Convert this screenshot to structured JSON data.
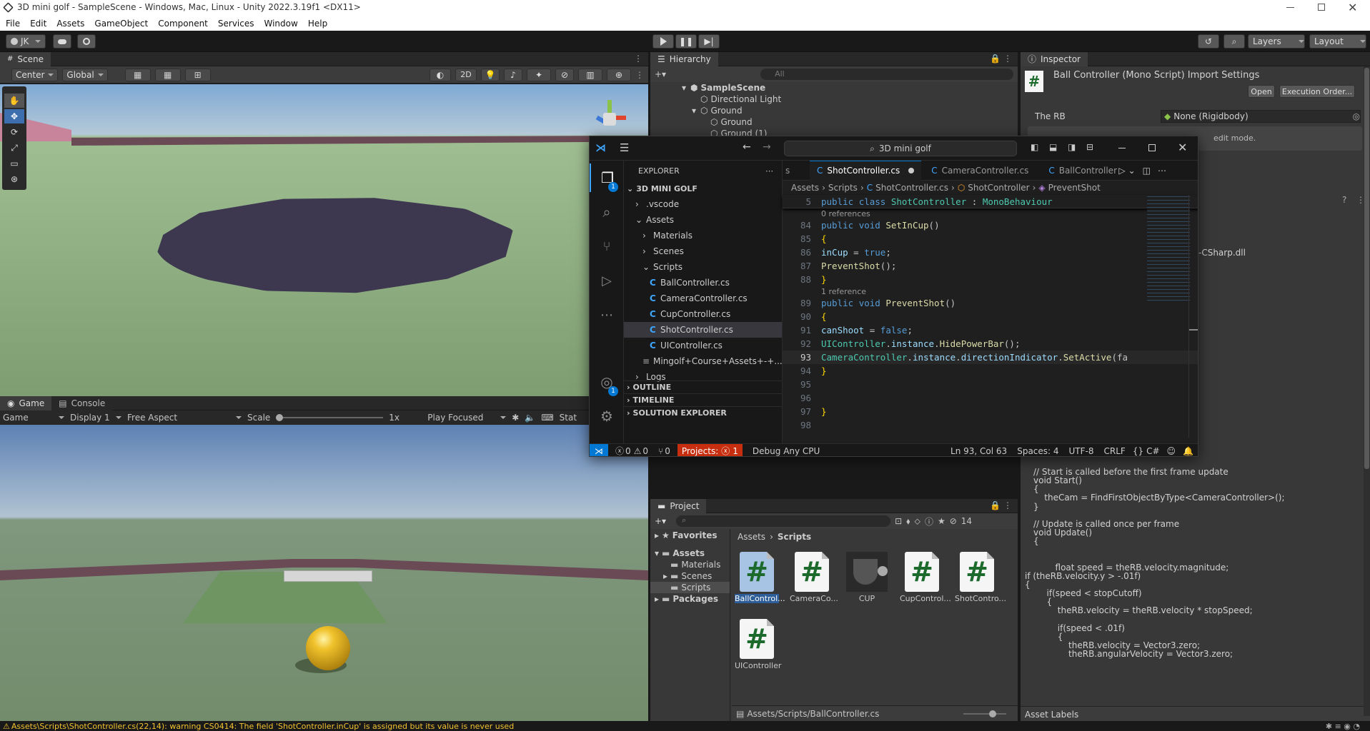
{
  "window_title": "3D mini golf - SampleScene - Windows, Mac, Linux - Unity 2022.3.19f1 <DX11>",
  "menu": [
    "File",
    "Edit",
    "Assets",
    "GameObject",
    "Component",
    "Services",
    "Window",
    "Help"
  ],
  "toolbar": {
    "account": "JK",
    "layers": "Layers",
    "layout": "Layout"
  },
  "scene": {
    "tab": "Scene",
    "pivot": "Center",
    "space": "Global",
    "mode2d": "2D"
  },
  "game": {
    "tab_game": "Game",
    "tab_console": "Console",
    "view": "Game",
    "display": "Display 1",
    "aspect": "Free Aspect",
    "scale_label": "Scale",
    "scale_value": "1x",
    "play_mode": "Play Focused",
    "stats": "Stat"
  },
  "hierarchy": {
    "tab": "Hierarchy",
    "search_placeholder": "All",
    "items": [
      {
        "label": "SampleScene",
        "indent": 0
      },
      {
        "label": "Directional Light",
        "indent": 1
      },
      {
        "label": "Ground",
        "indent": 1
      },
      {
        "label": "Ground",
        "indent": 2
      },
      {
        "label": "Ground (1)",
        "indent": 2
      }
    ]
  },
  "inspector": {
    "tab": "Inspector",
    "header": "Ball Controller (Mono Script) Import Settings",
    "open": "Open",
    "exec_order": "Execution Order...",
    "field_label": "The RB",
    "field_value": "None (Rigidbody)",
    "note": "edit mode.",
    "dll": "-CSharp.dll",
    "asset_labels": "Asset Labels",
    "code": [
      "// Start is called before the first frame update",
      "void Start()",
      "{",
      "    theCam = FindFirstObjectByType<CameraController>();",
      "}",
      "",
      "// Update is called once per frame",
      "void Update()",
      "{",
      "",
      "",
      "        float speed = theRB.velocity.magnitude;",
      "if (theRB.velocity.y > -.01f)",
      "{",
      "        if(speed < stopCutoff)",
      "        {",
      "            theRB.velocity = theRB.velocity * stopSpeed;",
      "",
      "            if(speed < .01f)",
      "            {",
      "                theRB.velocity = Vector3.zero;",
      "                theRB.angularVelocity = Vector3.zero;"
    ]
  },
  "project": {
    "tab": "Project",
    "hidden_count": "14",
    "favorites": "Favorites",
    "assets": "Assets",
    "folders": [
      "Materials",
      "Scenes",
      "Scripts"
    ],
    "packages": "Packages",
    "breadcrumb": [
      "Assets",
      "Scripts"
    ],
    "items": [
      "BallControl...",
      "CameraCo...",
      "CUP",
      "CupControl...",
      "ShotContro...",
      "UIController"
    ],
    "footer": "Assets/Scripts/BallController.cs"
  },
  "console_warning": "Assets\\Scripts\\ShotController.cs(22,14): warning CS0414: The field 'ShotController.inCup' is assigned but its value is never used",
  "vscode": {
    "search": "3D mini golf",
    "explorer_title": "EXPLORER",
    "workspace": "3D MINI GOLF",
    "tree": [
      {
        "label": ".vscode",
        "indent": 1,
        "type": "folder",
        "open": false
      },
      {
        "label": "Assets",
        "indent": 1,
        "type": "folder",
        "open": true
      },
      {
        "label": "Materials",
        "indent": 2,
        "type": "folder",
        "open": false
      },
      {
        "label": "Scenes",
        "indent": 2,
        "type": "folder",
        "open": false
      },
      {
        "label": "Scripts",
        "indent": 2,
        "type": "folder",
        "open": true
      },
      {
        "label": "BallController.cs",
        "indent": 3,
        "type": "cs"
      },
      {
        "label": "CameraController.cs",
        "indent": 3,
        "type": "cs"
      },
      {
        "label": "CupController.cs",
        "indent": 3,
        "type": "cs"
      },
      {
        "label": "ShotController.cs",
        "indent": 3,
        "type": "cs",
        "selected": true
      },
      {
        "label": "UIController.cs",
        "indent": 3,
        "type": "cs"
      },
      {
        "label": "Mingolf+Course+Assets+-+...",
        "indent": 2,
        "type": "file"
      },
      {
        "label": "Logs",
        "indent": 1,
        "type": "folder",
        "open": false
      }
    ],
    "sections": [
      "OUTLINE",
      "TIMELINE",
      "SOLUTION EXPLORER"
    ],
    "tabs": [
      {
        "label": "s",
        "active": false
      },
      {
        "label": "ShotController.cs",
        "active": true,
        "modified": true
      },
      {
        "label": "CameraController.cs",
        "active": false
      },
      {
        "label": "BallController.cs",
        "active": false
      }
    ],
    "breadcrumb": [
      "Assets",
      "Scripts",
      "ShotController.cs",
      "ShotController",
      "PreventShot"
    ],
    "sticky_line": {
      "n": "5",
      "text": "public class ShotController : MonoBehaviour"
    },
    "lines": [
      {
        "lens": "0 references"
      },
      {
        "n": "84",
        "text": "public void SetInCup()"
      },
      {
        "n": "85",
        "text": "{"
      },
      {
        "n": "86",
        "text": "inCup = true;"
      },
      {
        "n": "87",
        "text": "PreventShot();"
      },
      {
        "n": "88",
        "text": "}"
      },
      {
        "lens": "1 reference"
      },
      {
        "n": "89",
        "text": "public void PreventShot()"
      },
      {
        "n": "90",
        "text": "{"
      },
      {
        "n": "91",
        "text": "canShoot = false;"
      },
      {
        "n": "92",
        "text": "UIController.instance.HidePowerBar();"
      },
      {
        "n": "93",
        "text": "CameraController.instance.directionIndicator.SetActive(fa"
      },
      {
        "n": "94",
        "text": "}"
      },
      {
        "n": "95",
        "text": ""
      },
      {
        "n": "96",
        "text": ""
      },
      {
        "n": "97",
        "text": "}"
      },
      {
        "n": "98",
        "text": ""
      }
    ],
    "status": {
      "errors": "0",
      "warnings": "0",
      "ports": "0",
      "projects": "Projects:",
      "project_errors": "1",
      "config": "Debug Any CPU",
      "position": "Ln 93, Col 63",
      "spaces": "Spaces: 4",
      "encoding": "UTF-8",
      "eol": "CRLF",
      "lang": "C#"
    }
  }
}
